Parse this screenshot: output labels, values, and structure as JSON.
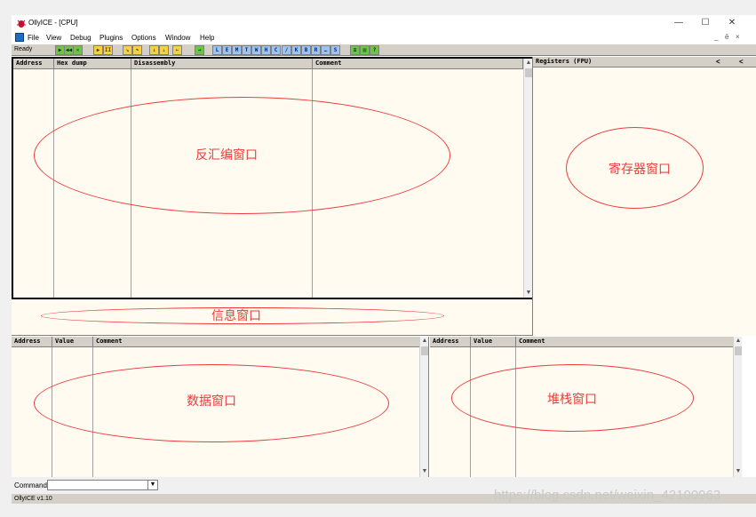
{
  "window": {
    "title": "OllyICE - [CPU]",
    "controls": {
      "minimize": "—",
      "maximize": "☐",
      "close": "✕"
    }
  },
  "menu": {
    "items": [
      "File",
      "View",
      "Debug",
      "Plugins",
      "Options",
      "Window",
      "Help"
    ],
    "mdi_controls": [
      "_",
      "ē",
      "×"
    ]
  },
  "toolbar": {
    "status": "Ready",
    "buttons": [
      {
        "glyph": "▶",
        "style": "green",
        "icon": "open-icon"
      },
      {
        "glyph": "◀◀",
        "style": "green",
        "icon": "restart-icon"
      },
      {
        "glyph": "✕",
        "style": "green",
        "icon": "close-icon"
      },
      {
        "glyph": "▶",
        "style": "yellow",
        "icon": "run-icon"
      },
      {
        "glyph": "II",
        "style": "yellow",
        "icon": "pause-icon"
      },
      {
        "glyph": "↘",
        "style": "yellow",
        "icon": "step-into-icon"
      },
      {
        "glyph": "↷",
        "style": "yellow",
        "icon": "step-over-icon"
      },
      {
        "glyph": "↓",
        "style": "yellow",
        "icon": "trace-into-icon"
      },
      {
        "glyph": "⇣",
        "style": "yellow",
        "icon": "trace-over-icon"
      },
      {
        "glyph": "←",
        "style": "yellow",
        "icon": "execute-till-return-icon"
      },
      {
        "glyph": "→",
        "style": "green",
        "icon": "go-to-icon"
      },
      {
        "glyph": "L",
        "style": "blue",
        "icon": "log-window-icon"
      },
      {
        "glyph": "E",
        "style": "blue",
        "icon": "modules-window-icon"
      },
      {
        "glyph": "M",
        "style": "blue",
        "icon": "memory-window-icon"
      },
      {
        "glyph": "T",
        "style": "blue",
        "icon": "threads-window-icon"
      },
      {
        "glyph": "W",
        "style": "blue",
        "icon": "windows-window-icon"
      },
      {
        "glyph": "H",
        "style": "blue",
        "icon": "handles-window-icon"
      },
      {
        "glyph": "C",
        "style": "blue",
        "icon": "cpu-window-icon"
      },
      {
        "glyph": "/",
        "style": "blue",
        "icon": "patches-window-icon"
      },
      {
        "glyph": "K",
        "style": "blue",
        "icon": "call-stack-window-icon"
      },
      {
        "glyph": "B",
        "style": "blue",
        "icon": "breakpoints-window-icon"
      },
      {
        "glyph": "R",
        "style": "blue",
        "icon": "references-window-icon"
      },
      {
        "glyph": "…",
        "style": "blue",
        "icon": "run-trace-window-icon"
      },
      {
        "glyph": "S",
        "style": "blue",
        "icon": "source-window-icon"
      },
      {
        "glyph": "≡",
        "style": "green",
        "icon": "options-icon"
      },
      {
        "glyph": "▤",
        "style": "green",
        "icon": "appearance-icon"
      },
      {
        "glyph": "?",
        "style": "green",
        "icon": "help-icon"
      }
    ]
  },
  "cpu": {
    "columns": [
      "Address",
      "Hex dump",
      "Disassembly",
      "Comment"
    ],
    "annotation": "反汇编窗口"
  },
  "registers": {
    "title": "Registers (FPU)",
    "nav": [
      "<",
      "<"
    ],
    "annotation": "寄存器窗口"
  },
  "info": {
    "annotation": "信息窗口"
  },
  "dump": {
    "columns": [
      "Address",
      "Value",
      "Comment"
    ],
    "annotation": "数据窗口"
  },
  "stack": {
    "columns": [
      "Address",
      "Value",
      "Comment"
    ],
    "annotation": "堆栈窗口"
  },
  "command": {
    "label": "Command",
    "value": ""
  },
  "status": {
    "text": "OllyICE v1.10"
  },
  "watermark": "https://blog.csdn.net/weixin_42100963",
  "colors": {
    "annotation": "#ee3b3b",
    "pane_bg": "#fffbf0",
    "header_bg": "#d4d0c8"
  }
}
